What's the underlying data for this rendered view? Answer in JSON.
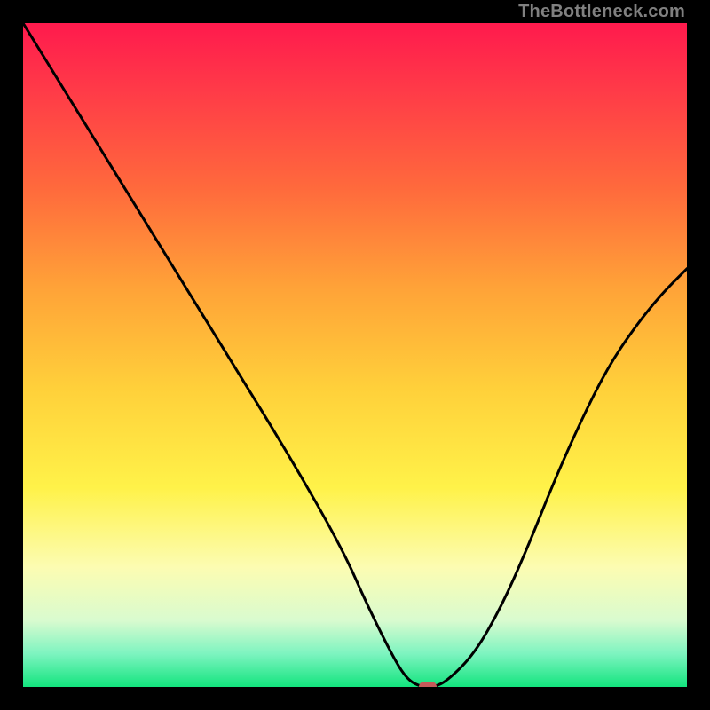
{
  "watermark": "TheBottleneck.com",
  "chart_data": {
    "type": "line",
    "title": "",
    "xlabel": "",
    "ylabel": "",
    "xlim": [
      0,
      100
    ],
    "ylim": [
      0,
      100
    ],
    "grid": false,
    "legend": false,
    "series": [
      {
        "name": "bottleneck-curve",
        "x": [
          0,
          8,
          16,
          24,
          32,
          40,
          48,
          52,
          56,
          58,
          60,
          62,
          64,
          68,
          72,
          76,
          80,
          84,
          88,
          92,
          96,
          100
        ],
        "values": [
          100,
          87,
          74,
          61,
          48,
          35,
          21,
          12,
          4,
          1,
          0,
          0,
          1,
          5,
          12,
          21,
          31,
          40,
          48,
          54,
          59,
          63
        ]
      }
    ],
    "marker": {
      "x": 61,
      "y": 0
    },
    "background_gradient": {
      "top": "#ff1a4d",
      "bottom": "#13e47e"
    }
  }
}
